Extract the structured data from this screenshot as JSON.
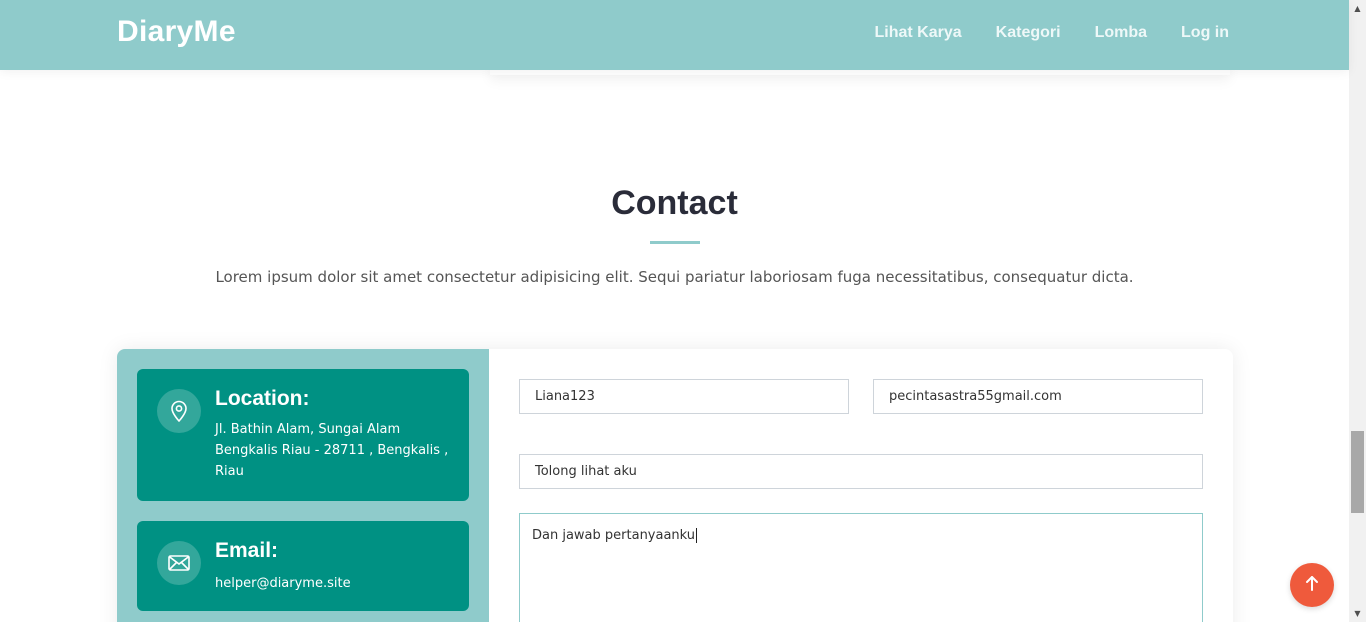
{
  "header": {
    "logo": "DiaryMe",
    "nav": [
      "Lihat Karya",
      "Kategori",
      "Lomba",
      "Log in"
    ]
  },
  "section": {
    "title": "Contact",
    "description": "Lorem ipsum dolor sit amet consectetur adipisicing elit. Sequi pariatur laboriosam fuga necessitatibus, consequatur dicta."
  },
  "info": {
    "location": {
      "icon": "map-pin-icon",
      "title": "Location:",
      "text": "Jl. Bathin Alam, Sungai Alam Bengkalis Riau - 28711 , Bengkalis , Riau"
    },
    "email": {
      "icon": "envelope-icon",
      "title": "Email:",
      "text": "helper@diaryme.site"
    }
  },
  "form": {
    "name_value": "Liana123",
    "email_value": "pecintasastra55gmail.com",
    "subject_value": "Tolong lihat aku",
    "message_value": "Dan jawab pertanyaanku"
  },
  "colors": {
    "header_bg": "#8fcbcb",
    "info_box": "#009183",
    "back_to_top": "#ef5a3c"
  },
  "back_to_top": {
    "icon": "arrow-up-icon"
  }
}
